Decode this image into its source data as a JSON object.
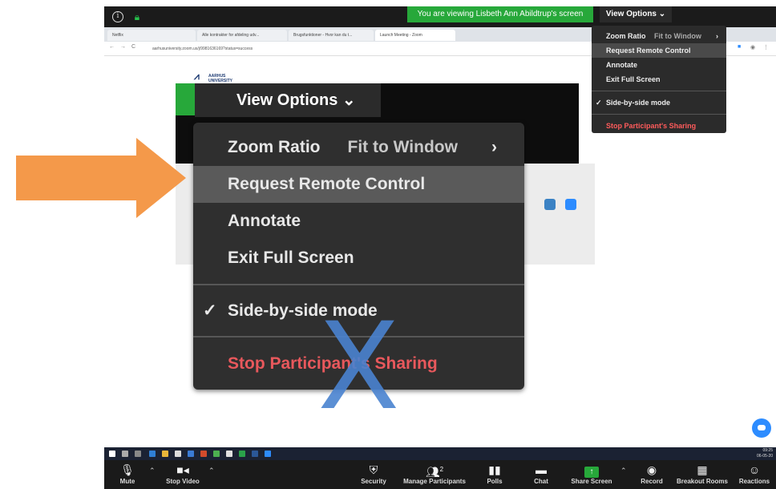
{
  "zoom": {
    "viewing_banner": "You are viewing Lisbeth Ann Abildtrup's screen",
    "view_options_label": "View Options",
    "view_options_chevron": "⌄"
  },
  "small_menu": {
    "zoom_ratio": "Zoom Ratio",
    "zoom_ratio_value": "Fit to Window",
    "request_remote_control": "Request Remote Control",
    "annotate": "Annotate",
    "exit_full_screen": "Exit Full Screen",
    "side_by_side": "Side-by-side mode",
    "stop_sharing": "Stop Participant's Sharing"
  },
  "big_menu": {
    "view_options_label": "View Options",
    "chevron": "⌄",
    "zoom_ratio": "Zoom Ratio",
    "zoom_ratio_value": "Fit to Window",
    "submenu_chevron": "›",
    "request_remote_control": "Request Remote Control",
    "annotate": "Annotate",
    "exit_full_screen": "Exit Full Screen",
    "check": "✓",
    "side_by_side": "Side-by-side mode",
    "stop_sharing": "Stop Participant's Sharing"
  },
  "browser": {
    "tabs": [
      "Netflix",
      "Alle kontrakter for afdeling udv...",
      "Brugsfunktioner - Hvor kan du t...",
      "Launch Meeting - Zoom"
    ],
    "url": "aarhusuniversity.zoom.us/j/9981636169?status=success",
    "logo_line1": "AARHUS",
    "logo_line2": "UNIVERSITY"
  },
  "taskbar": {
    "time": "09:25",
    "date": "06-05-20"
  },
  "toolbar": {
    "mute": "Mute",
    "stop_video": "Stop Video",
    "security": "Security",
    "manage_participants": "Manage Participants",
    "participants_count": "2",
    "polls": "Polls",
    "chat": "Chat",
    "share_screen": "Share Screen",
    "record": "Record",
    "breakout_rooms": "Breakout Rooms",
    "reactions": "Reactions"
  },
  "overlay": {
    "x_mark": "X"
  },
  "colors": {
    "arrow": "#f4994a",
    "x_mark": "#4a83d0",
    "green": "#27a83a",
    "stop_red": "#e8585c"
  }
}
